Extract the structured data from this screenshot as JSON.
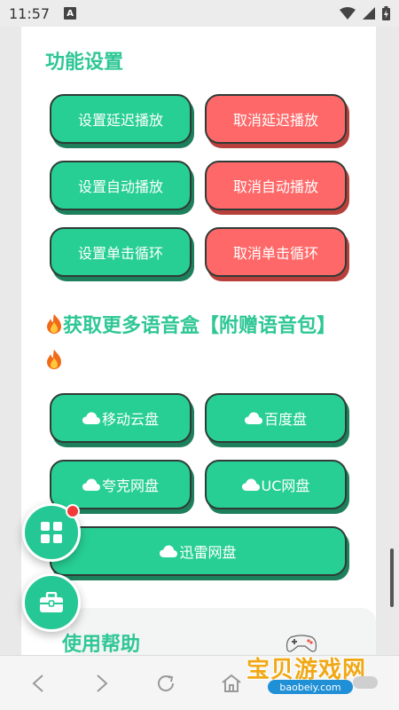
{
  "status_bar": {
    "time": "11:57",
    "notification_letter": "A"
  },
  "sections": {
    "settings_title": "功能设置",
    "download_title": "获取更多语音盒【附赠语音包】",
    "help_title": "使用帮助"
  },
  "settings_buttons": {
    "set_delay": "设置延迟播放",
    "cancel_delay": "取消延迟播放",
    "set_auto": "设置自动播放",
    "cancel_auto": "取消自动播放",
    "set_loop": "设置单击循环",
    "cancel_loop": "取消单击循环"
  },
  "download_buttons": {
    "mobile_cloud": "移动云盘",
    "baidu": "百度盘",
    "quark": "夸克网盘",
    "uc": "UC网盘",
    "xunlei": "迅雷网盘"
  },
  "watermark": {
    "text": "宝贝游戏网",
    "url": "baobeiy.com"
  },
  "colors": {
    "green": "#27cf95",
    "red": "#ff6868",
    "title_green": "#2ec795",
    "badge_red": "#f33a3a"
  },
  "icons": [
    "flame-icon",
    "cloud-icon",
    "grid-icon",
    "toolbox-icon",
    "back-icon",
    "forward-icon",
    "refresh-icon",
    "home-icon",
    "wifi-icon",
    "signal-icon",
    "battery-icon"
  ]
}
